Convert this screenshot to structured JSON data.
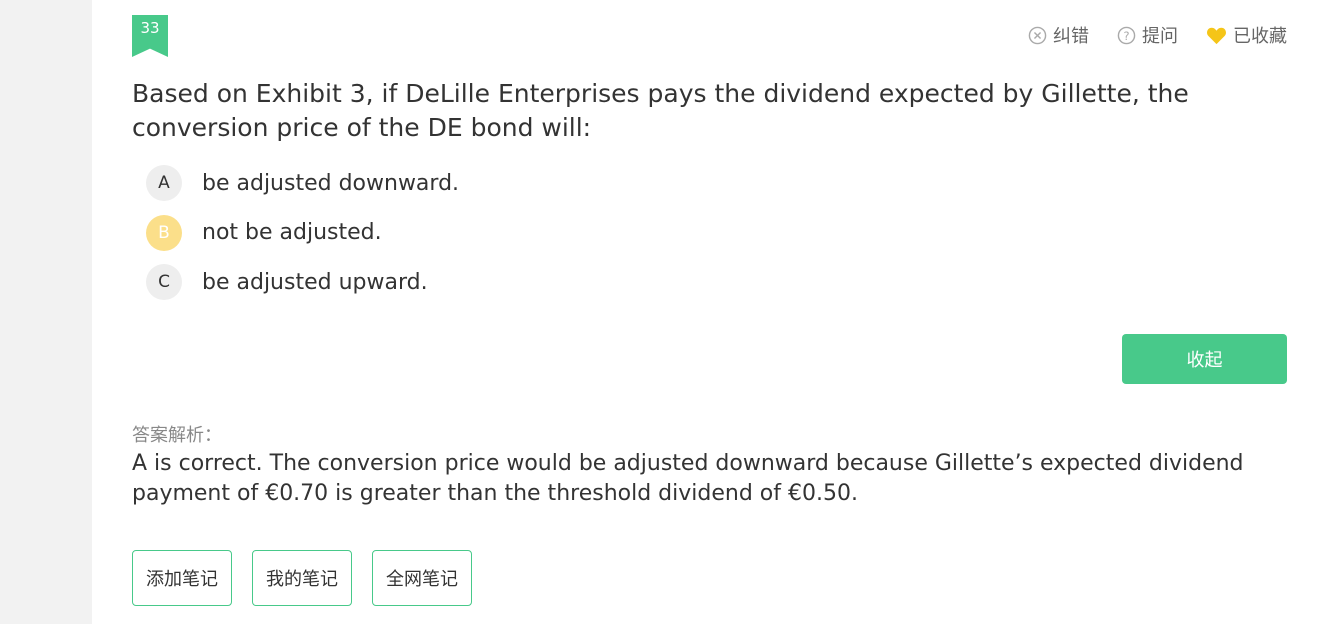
{
  "question": {
    "number": "33",
    "text": "Based on Exhibit 3, if DeLille Enterprises pays the dividend expected by Gillette, the conversion price of the DE bond will:"
  },
  "actions": {
    "report_error": "纠错",
    "ask": "提问",
    "favorited": "已收藏"
  },
  "options": [
    {
      "letter": "A",
      "text": "be adjusted downward.",
      "selected": false
    },
    {
      "letter": "B",
      "text": "not be adjusted.",
      "selected": true
    },
    {
      "letter": "C",
      "text": "be adjusted upward.",
      "selected": false
    }
  ],
  "collapse_label": "收起",
  "analysis": {
    "label": "答案解析：",
    "text": "A is correct. The conversion price would be adjusted downward because Gillette’s expected dividend payment of €0.70 is greater than the threshold dividend of €0.50."
  },
  "notes": {
    "add": "添加笔记",
    "mine": "我的笔记",
    "all": "全网笔记"
  },
  "colors": {
    "accent": "#48c98a",
    "selected_option": "#fbdf8a",
    "favorite_heart": "#f5c518"
  },
  "icons": {
    "report_error": "circle-x-icon",
    "ask": "question-circle-icon",
    "favorited": "heart-icon"
  }
}
